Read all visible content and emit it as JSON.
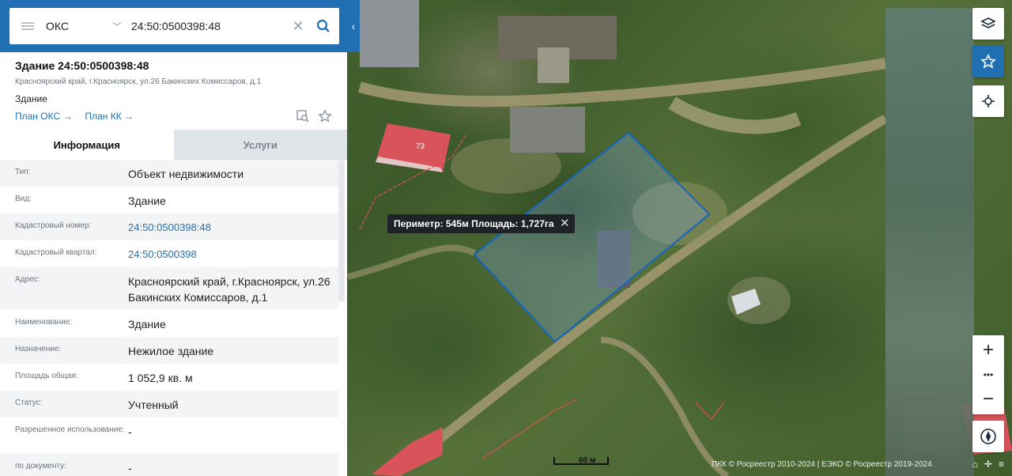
{
  "search": {
    "type_label": "ОКС",
    "query": "24:50:0500398:48"
  },
  "object": {
    "title": "Здание 24:50:0500398:48",
    "address_short": "Красноярский край, г.Красноярск, ул.26 Бакинских Комиссаров, д.1",
    "kind": "Здание",
    "link_oks": "План ОКС →",
    "link_kk": "План КК →"
  },
  "tabs": [
    {
      "label": "Информация",
      "active": true
    },
    {
      "label": "Услуги",
      "active": false
    }
  ],
  "properties": [
    {
      "key": "Тип:",
      "value": "Объект недвижимости",
      "link": false
    },
    {
      "key": "Вид:",
      "value": "Здание",
      "link": false
    },
    {
      "key": "Кадастровый номер:",
      "value": "24:50:0500398:48",
      "link": true
    },
    {
      "key": "Кадастровый квартал:",
      "value": "24:50:0500398",
      "link": true
    },
    {
      "key": "Адрес:",
      "value": "Красноярский край, г.Красноярск, ул.26 Бакинских Комиссаров, д.1",
      "link": false
    },
    {
      "key": "Наименование:",
      "value": "Здание",
      "link": false
    },
    {
      "key": "Назначение:",
      "value": "Нежилое здание",
      "link": false
    },
    {
      "key": "Площадь общая:",
      "value": "1 052,9 кв. м",
      "link": false
    },
    {
      "key": "Статус:",
      "value": "Учтенный",
      "link": false
    },
    {
      "key": "Разрешенное использование:",
      "value": "-",
      "link": false
    },
    {
      "key": "по документу:",
      "value": "-",
      "link": false
    }
  ],
  "map": {
    "measure_label": "Периметр: 545м Площадь: 1,727га",
    "building_label": "73",
    "scale_label": "60 м",
    "attribution": "ПКК © Росреестр 2010-2024 | ЕЭКО © Росреестр 2019-2024",
    "zoom_in": "+",
    "zoom_more": "•••",
    "zoom_out": "−"
  },
  "colors": {
    "accent": "#1f6fb2",
    "parcel_stroke": "#1565c0",
    "roof_red": "#d9535a"
  },
  "icons": [
    "menu-icon",
    "chevron-down-icon",
    "clear-icon",
    "search-icon",
    "collapse-panel-icon",
    "plan-icon",
    "star-icon",
    "layers-icon",
    "favorites-icon",
    "locate-icon",
    "compass-icon",
    "close-icon",
    "home-icon"
  ]
}
